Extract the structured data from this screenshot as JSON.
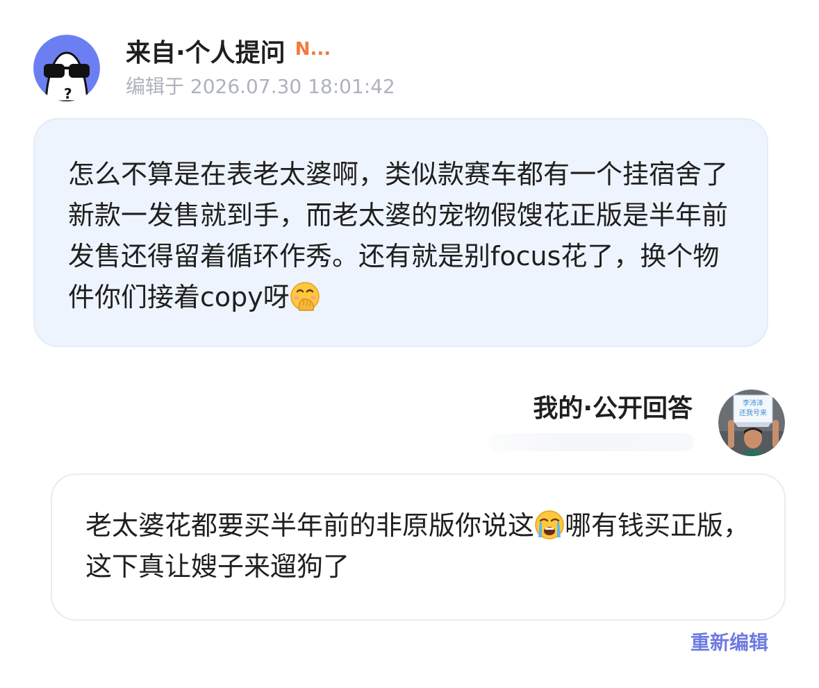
{
  "question": {
    "author": "来自·个人提问",
    "badge": "N...",
    "timestamp": "编辑于 2026.07.30 18:01:42",
    "text_part1": "怎么不算是在表老太婆啊，类似款赛车都有一个挂宿舍了新款一发售就到手，而老太婆的宠物假馊花正版是半年前发售还得留着循环作秀。还有就是别focus花了，换个物件你们接着copy呀",
    "emoji": "hand-over-mouth-emoji"
  },
  "answer": {
    "author": "我的·公开回答",
    "avatar_sign_line1": "李沛泽",
    "avatar_sign_line2": "还我号来",
    "text_part1": "老太婆花都要买半年前的非原版你说这",
    "emoji": "loudly-crying-emoji",
    "text_part2": "哪有钱买正版，这下真让嫂子来遛狗了",
    "reedit_label": "重新编辑"
  },
  "colors": {
    "question_bubble_bg": "#eef4fd",
    "badge": "#f07a3c",
    "link": "#6e7be0",
    "avatar_bg": "#6c7ff2"
  }
}
